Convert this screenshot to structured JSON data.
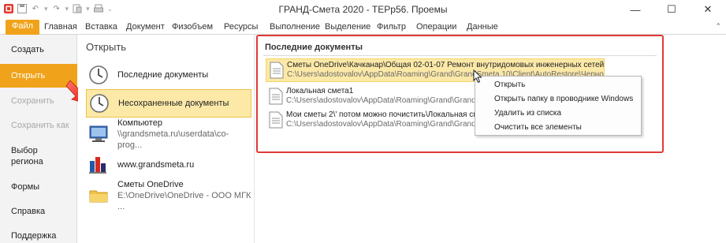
{
  "window": {
    "title": "ГРАНД-Смета 2020 - ТЕРр56. Проемы",
    "minimize_glyph": "—",
    "maximize_glyph": "☐",
    "close_glyph": "✕"
  },
  "qat": {
    "undo_glyph": "↶",
    "redo_glyph": "↷",
    "dropdown_glyph": "▾",
    "more_glyph": "⌄"
  },
  "ribbon": {
    "tabs": [
      "Файл",
      "Главная",
      "Вставка",
      "Документ",
      "Физобъем",
      "Ресурсы",
      "Выполнение",
      "Выделение",
      "Фильтр",
      "Операции",
      "Данные"
    ],
    "collapse_glyph": "⌃"
  },
  "nav": {
    "items": [
      "Создать",
      "Открыть",
      "Сохранить",
      "Сохранить как",
      "Выбор региона",
      "Формы",
      "Справка",
      "Поддержка"
    ]
  },
  "open_panel": {
    "header": "Открыть",
    "items": [
      {
        "title": "Последние документы",
        "subtitle": ""
      },
      {
        "title": "Несохраненные документы",
        "subtitle": ""
      },
      {
        "title": "Компьютер",
        "subtitle": "\\\\grandsmeta.ru\\userdata\\co-prog..."
      },
      {
        "title": "www.grandsmeta.ru",
        "subtitle": ""
      },
      {
        "title": "Сметы OneDrive",
        "subtitle": "E:\\OneDrive\\OneDrive - ООО МГК ..."
      }
    ]
  },
  "recent": {
    "header": "Последние документы",
    "docs": [
      {
        "title": "Сметы OneDrive\\Качканар\\Общая 02-01-07 Ремонт внутридомовых инженерных сетей электрос...",
        "path": "C:\\Users\\adostovalov\\AppData\\Roaming\\Grand\\GrandSmeta 10\\Client\\AutoRestore\\Черновик Общая ..."
      },
      {
        "title": "Локальная смета1",
        "path": "C:\\Users\\adostovalov\\AppData\\Roaming\\Grand\\GrandSmeta 1"
      },
      {
        "title": "Мои сметы 2\\' потом можно почистить\\Локальная смета1 с",
        "path": "C:\\Users\\adostovalov\\AppData\\Roaming\\Grand\\GrandSmeta 1"
      }
    ]
  },
  "context_menu": {
    "items": [
      "Открыть",
      "Открыть папку в проводнике Windows",
      "Удалить из списка",
      "Очистить все элементы"
    ]
  },
  "colors": {
    "accent": "#f0a31a",
    "highlight": "#fce9a8",
    "frame": "#e03a3a"
  }
}
